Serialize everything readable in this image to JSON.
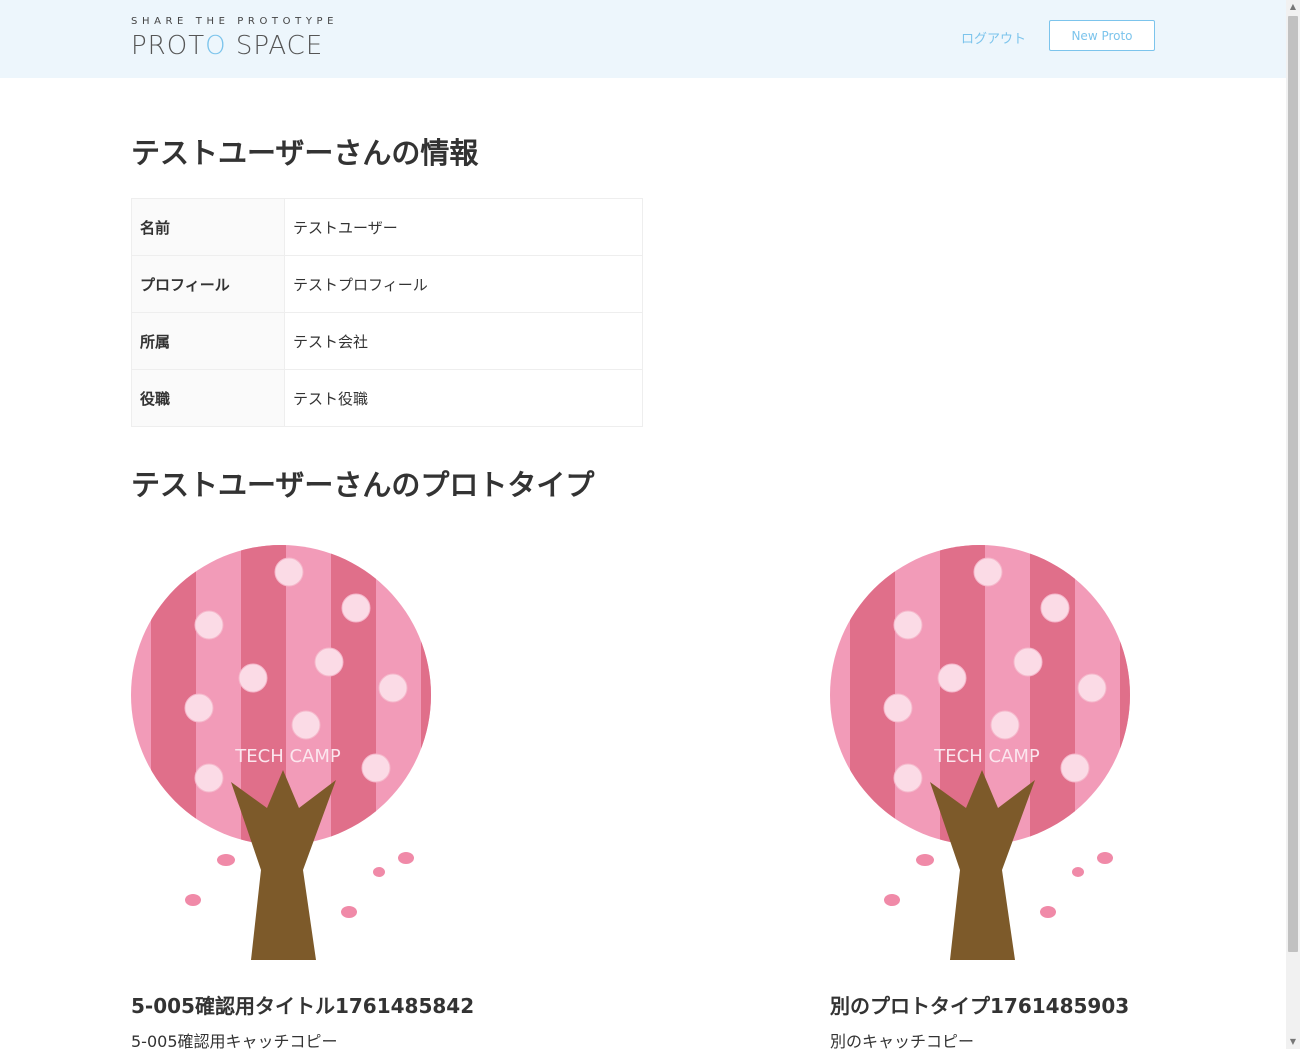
{
  "header": {
    "logo_tagline": "SHARE THE PROTOTYPE",
    "logo_proto": "PROT",
    "logo_o": "O",
    "logo_space": " SPACE",
    "logout_label": "ログアウト",
    "new_proto_label": "New Proto"
  },
  "user_info": {
    "heading": "テストユーザーさんの情報",
    "rows": [
      {
        "label": "名前",
        "value": "テストユーザー"
      },
      {
        "label": "プロフィール",
        "value": "テストプロフィール"
      },
      {
        "label": "所属",
        "value": "テスト会社"
      },
      {
        "label": "役職",
        "value": "テスト役職"
      }
    ]
  },
  "prototypes": {
    "heading": "テストユーザーさんのプロトタイプ",
    "items": [
      {
        "image_text": "TECH CAMP",
        "title": "5-005確認用タイトル1761485842",
        "catch_copy": "5-005確認用キャッチコピー"
      },
      {
        "image_text": "TECH CAMP",
        "title": "別のプロトタイプ1761485903",
        "catch_copy": "別のキャッチコピー"
      }
    ]
  },
  "colors": {
    "header_bg": "#edf6fc",
    "accent": "#7cc4ec"
  }
}
